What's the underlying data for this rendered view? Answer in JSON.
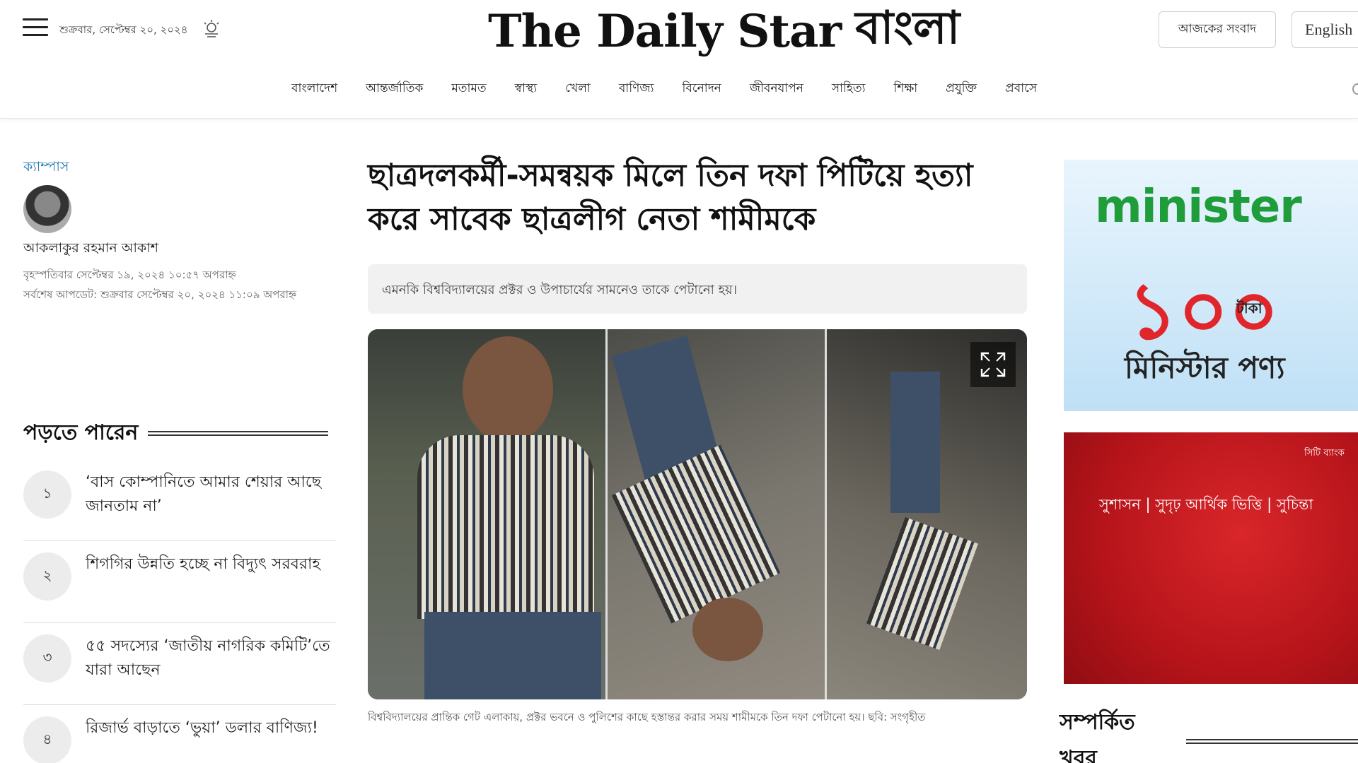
{
  "header": {
    "date": "শুক্রবার, সেপ্টেম্বর ২০, ২০২৪",
    "logo_en": "The Daily Star",
    "logo_bn": "বাংলা",
    "today_button": "আজকের সংবাদ",
    "english_button": "English"
  },
  "nav": [
    "বাংলাদেশ",
    "আন্তর্জাতিক",
    "মতামত",
    "স্বাস্থ্য",
    "খেলা",
    "বাণিজ্য",
    "বিনোদন",
    "জীবনযাপন",
    "সাহিত্য",
    "শিক্ষা",
    "প্রযুক্তি",
    "প্রবাসে"
  ],
  "article": {
    "category": "ক্যাম্পাস",
    "author": "আকলাকুর রহমান আকাশ",
    "published": "বৃহস্পতিবার সেপ্টেম্বর ১৯, ২০২৪ ১০:৫৭ অপরাহ্ন",
    "updated": "সর্বশেষ আপডেট: শুক্রবার সেপ্টেম্বর ২০, ২০২৪ ১১:০৯ অপরাহ্ন",
    "headline": "ছাত্রদলকর্মী-সমন্বয়ক মিলে তিন দফা পিটিয়ে হত্যা করে সাবেক ছাত্রলীগ নেতা শামীমকে",
    "summary": "এমনকি বিশ্ববিদ্যালয়ের প্রক্টর ও উপাচার্যের সামনেও তাকে পেটানো হয়।",
    "caption": "বিশ্ববিদ্যালয়ের প্রান্তিক গেট এলাকায়, প্রক্টর ভবনে ও পুলিশের কাছে হস্তান্তর করার সময় শামীমকে তিন দফা পেটানো হয়। ছবি: সংগৃহীত"
  },
  "may_read": {
    "title": "পড়তে পারেন",
    "items": [
      {
        "num": "১",
        "text": "‘বাস কোম্পানিতে আমার শেয়ার আছে জানতাম না’"
      },
      {
        "num": "২",
        "text": "শিগগির উন্নতি হচ্ছে না বিদ্যুৎ সরবরাহ"
      },
      {
        "num": "৩",
        "text": "৫৫ সদস্যের ‘জাতীয় নাগরিক কমিটি’তে যারা আছেন"
      },
      {
        "num": "৪",
        "text": "রিজার্ভ বাড়াতে ‘ভুয়া’ ডলার বাণিজ্য!"
      }
    ]
  },
  "ads": {
    "ad1_brand": "minister",
    "ad1_number": "১০০",
    "ad1_taka": "টাকা",
    "ad1_product": "মিনিস্টার পণ্য",
    "ad2_logo": "সিটি ব্যাংক",
    "ad2_tagline": "সুশাসন | সুদৃঢ় আর্থিক ভিত্তি | সুচিন্তা"
  },
  "related": {
    "title": "সম্পর্কিত খবর"
  },
  "colors": {
    "category_blue": "#1f78b4",
    "ad_green": "#1f9d3a",
    "ad_red": "#d9262a"
  }
}
